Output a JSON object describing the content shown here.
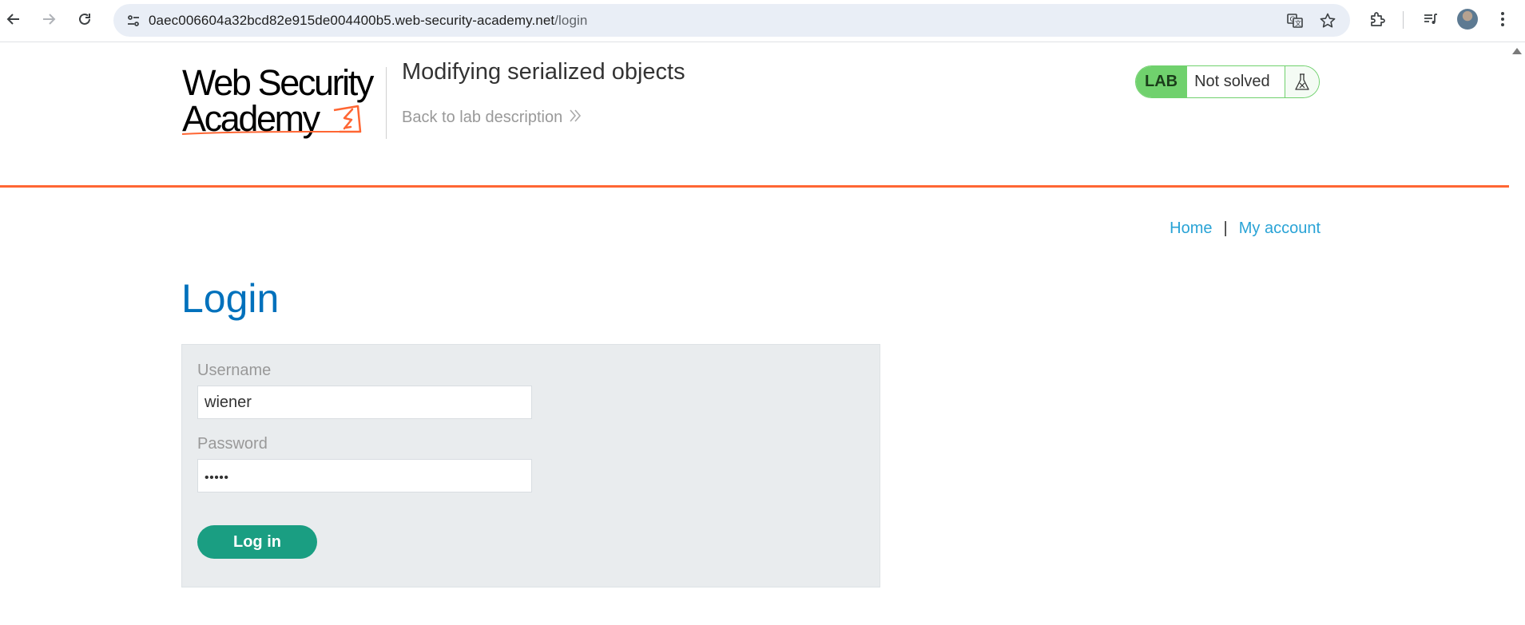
{
  "browser": {
    "url_host": "0aec006604a32bcd82e915de004400b5.web-security-academy.net",
    "url_path": "/login"
  },
  "header": {
    "logo_line1": "Web Security",
    "logo_line2": "Academy",
    "lab_title": "Modifying serialized objects",
    "back_link": "Back to lab description",
    "lab_badge": "LAB",
    "lab_status": "Not solved",
    "accent_color": "#ff6633",
    "status_color": "#70d16d"
  },
  "nav": {
    "home": "Home",
    "separator": "|",
    "my_account": "My account"
  },
  "login": {
    "heading": "Login",
    "username_label": "Username",
    "username_value": "wiener",
    "password_label": "Password",
    "password_masked": "•••••",
    "submit_label": "Log in",
    "button_color": "#1a9e82"
  }
}
